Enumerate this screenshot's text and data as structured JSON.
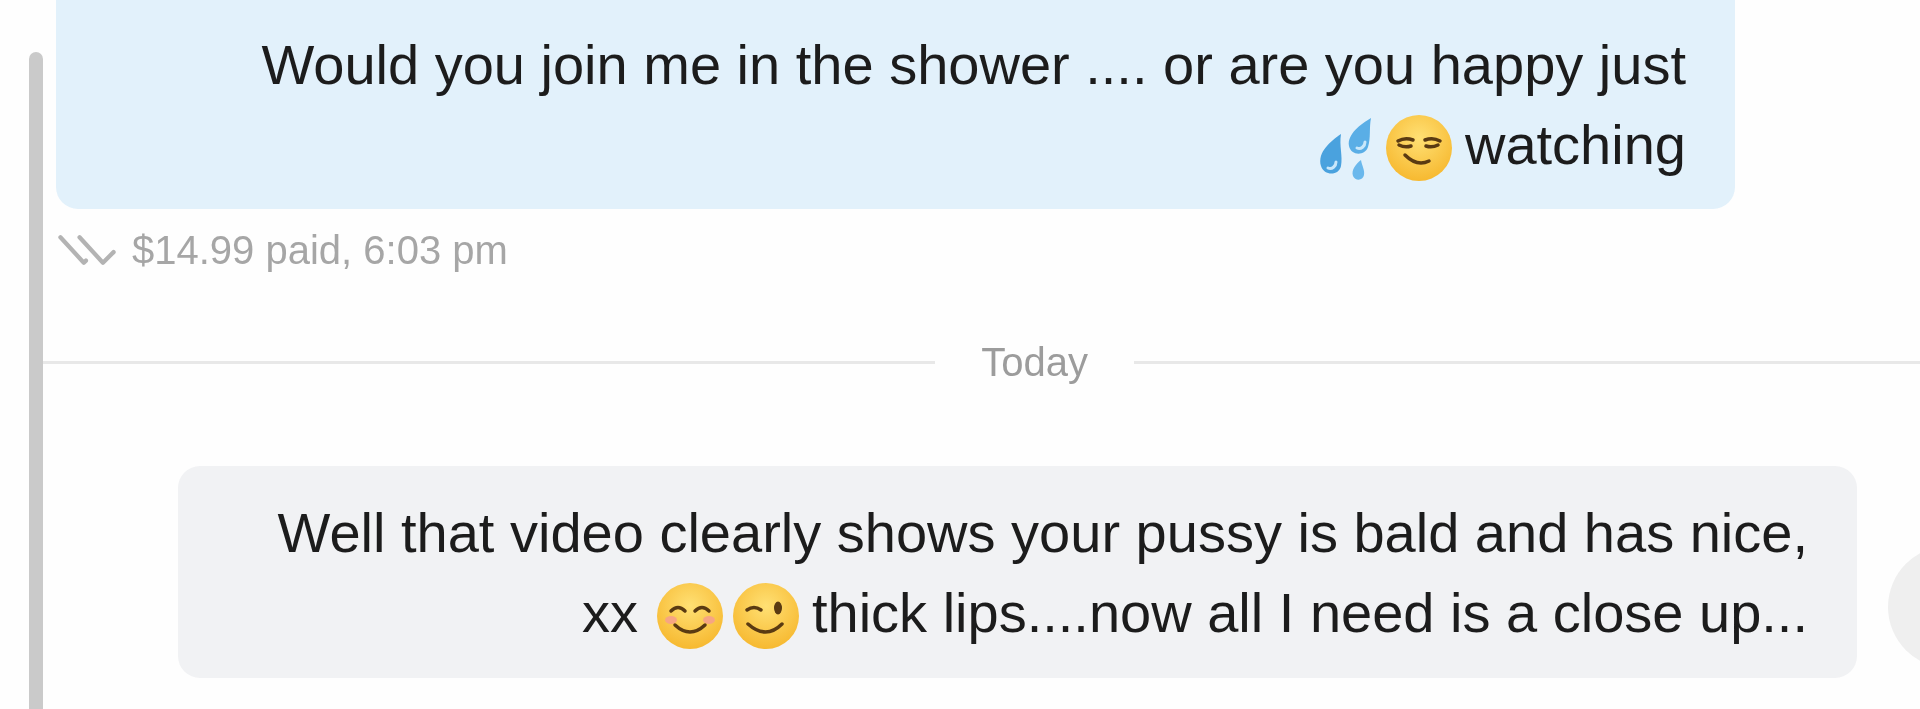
{
  "conversation": [
    {
      "kind": "sent_message",
      "lines": [
        [
          {
            "kind": "text",
            "text": "Would you join me in the shower .... or are you happy just"
          }
        ],
        [
          {
            "kind": "emoji"
          },
          {
            "kind": "emoji"
          },
          {
            "kind": "text",
            "text": "watching"
          }
        ]
      ],
      "meta": "$14.99 paid, 6:03 pm",
      "read": true
    },
    {
      "kind": "date_separator",
      "label": "Today"
    },
    {
      "kind": "received_message",
      "lines": [
        [
          {
            "kind": "text",
            "text": "Well that video clearly shows your pussy is bald and has nice,"
          }
        ],
        [
          {
            "kind": "text",
            "text": "xx"
          },
          {
            "kind": "emoji"
          },
          {
            "kind": "emoji"
          },
          {
            "kind": "text",
            "text": "thick lips....now all I need is a close up..."
          }
        ]
      ]
    }
  ]
}
